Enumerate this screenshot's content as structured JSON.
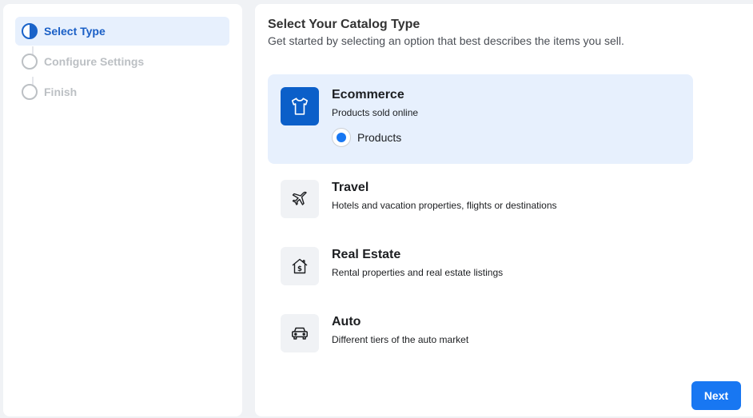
{
  "steps": [
    {
      "label": "Select Type",
      "state": "current"
    },
    {
      "label": "Configure Settings",
      "state": "pending"
    },
    {
      "label": "Finish",
      "state": "pending"
    }
  ],
  "header": {
    "title": "Select Your Catalog Type",
    "subtitle": "Get started by selecting an option that best describes the items you sell."
  },
  "options": [
    {
      "name": "Ecommerce",
      "desc": "Products sold online",
      "icon": "tshirt-icon",
      "selected": true,
      "sub_option": {
        "label": "Products",
        "checked": true
      }
    },
    {
      "name": "Travel",
      "desc": "Hotels and vacation properties, flights or destinations",
      "icon": "airplane-icon",
      "selected": false
    },
    {
      "name": "Real Estate",
      "desc": "Rental properties and real estate listings",
      "icon": "house-dollar-icon",
      "selected": false
    },
    {
      "name": "Auto",
      "desc": "Different tiers of the auto market",
      "icon": "car-icon",
      "selected": false
    }
  ],
  "footer": {
    "next_label": "Next"
  },
  "colors": {
    "accent": "#1877f2",
    "selected_bg": "#e7f0fd",
    "selected_icon_bg": "#0b5fc9"
  }
}
